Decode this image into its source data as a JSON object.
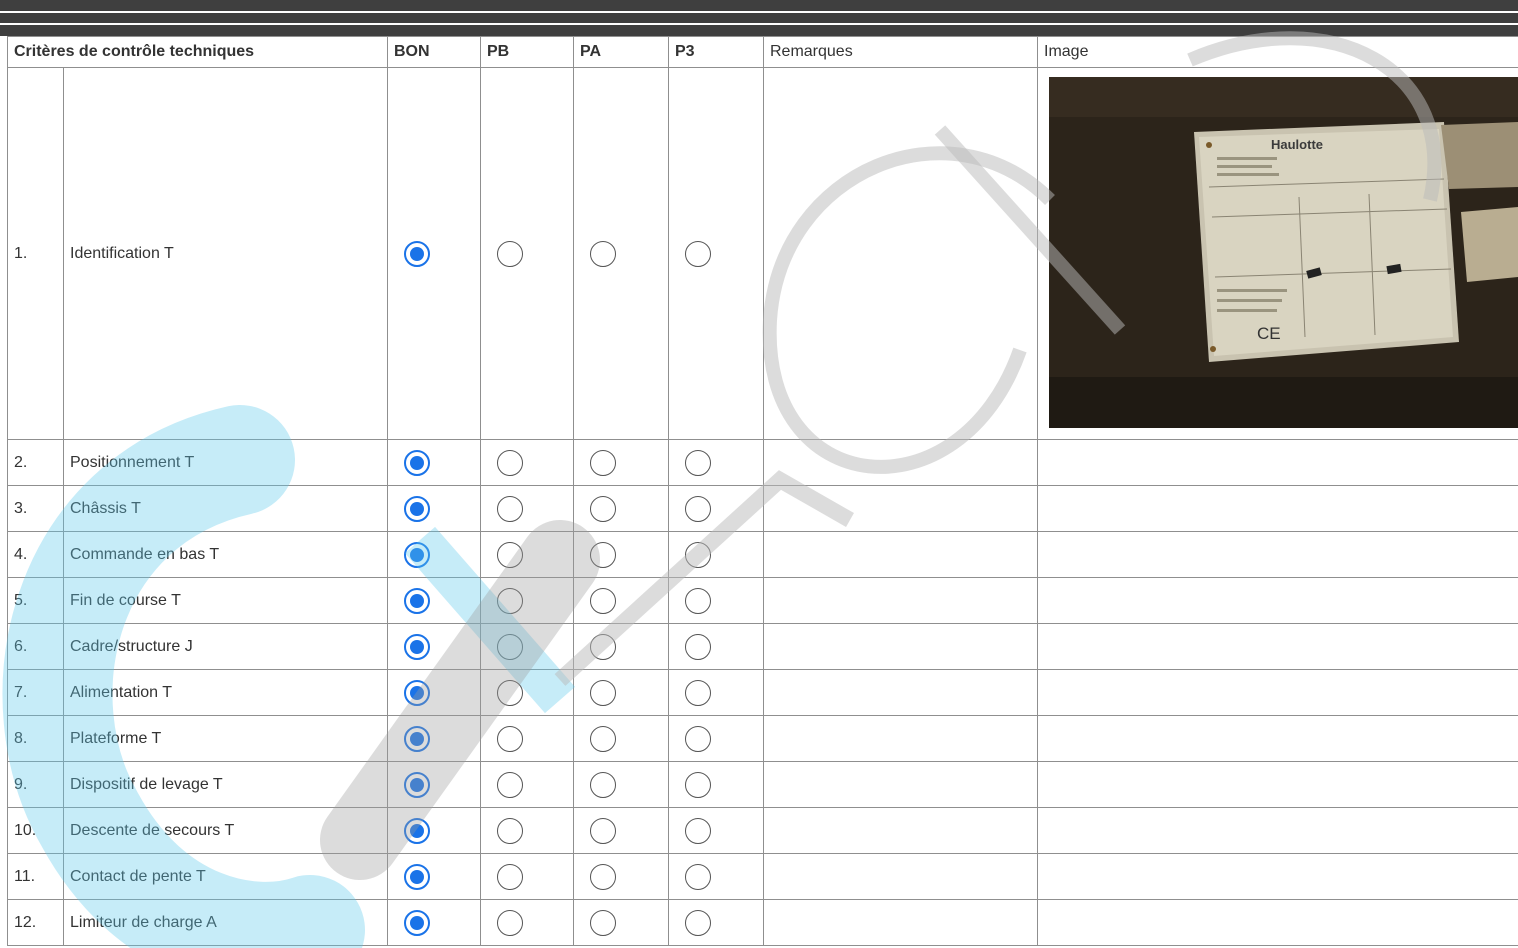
{
  "table": {
    "headers": {
      "criteria": "Critères de contrôle techniques",
      "bon": "BON",
      "pb": "PB",
      "pa": "PA",
      "p3": "P3",
      "remarks": "Remarques",
      "image": "Image"
    },
    "rows": [
      {
        "num": "1.",
        "label": "Identification T",
        "selected": "BON"
      },
      {
        "num": "2.",
        "label": "Positionnement T",
        "selected": "BON"
      },
      {
        "num": "3.",
        "label": "Châssis T",
        "selected": "BON"
      },
      {
        "num": "4.",
        "label": "Commande en bas T",
        "selected": "BON"
      },
      {
        "num": "5.",
        "label": "Fin de course T",
        "selected": "BON"
      },
      {
        "num": "6.",
        "label": "Cadre/structure J",
        "selected": "BON"
      },
      {
        "num": "7.",
        "label": "Alimentation T",
        "selected": "BON"
      },
      {
        "num": "8.",
        "label": "Plateforme T",
        "selected": "BON"
      },
      {
        "num": "9.",
        "label": "Dispositif de levage T",
        "selected": "BON"
      },
      {
        "num": "10.",
        "label": "Descente de secours T",
        "selected": "BON"
      },
      {
        "num": "11.",
        "label": "Contact de pente T",
        "selected": "BON"
      },
      {
        "num": "12.",
        "label": "Limiteur de charge A",
        "selected": "BON"
      }
    ]
  },
  "photo": {
    "brand_text": "Haulotte",
    "mark_text": "CE"
  },
  "colors": {
    "accent_radio": "#1a73e8",
    "header_bars": "#3f3f3f",
    "watermark_cyan": "#5cc8ec",
    "watermark_gray": "#b9b9b9"
  }
}
